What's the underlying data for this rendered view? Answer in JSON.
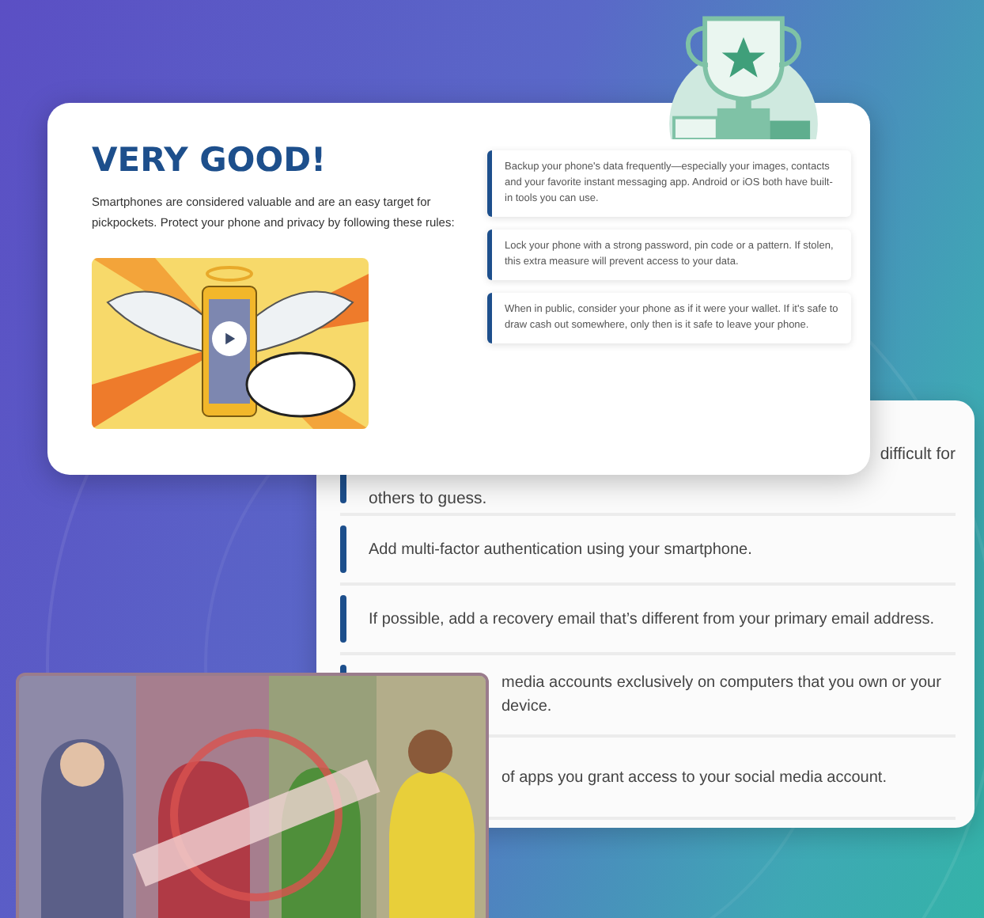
{
  "hero_card": {
    "title": "VERY GOOD!",
    "intro": "Smartphones are considered valuable and are an easy target for pickpockets. Protect your phone and privacy by following these rules:",
    "tips": [
      {
        "text": "Backup your phone's data frequently—especially your images, contacts and your favorite instant messaging app. Android or iOS both have built-in tools you can use."
      },
      {
        "text": "Lock your phone with a strong password, pin code or a pattern. If stolen, this extra measure will prevent access to your data."
      },
      {
        "text": "When in public, consider your phone as if it were your wallet. If it's safe to draw cash out somewhere, only then is it safe to leave your phone."
      }
    ]
  },
  "tips_card": {
    "tips": [
      {
        "kind": "partial",
        "line_end": "difficult for",
        "text": "others to guess."
      },
      {
        "kind": "full",
        "text": "Add multi-factor authentication using your smartphone."
      },
      {
        "kind": "full",
        "text": "If possible, add a recovery email that’s different from your primary email address."
      },
      {
        "kind": "covered",
        "text": "media accounts exclusively on computers that you own or your device."
      },
      {
        "kind": "covered",
        "text": "of apps you grant access to your social media account."
      }
    ]
  }
}
